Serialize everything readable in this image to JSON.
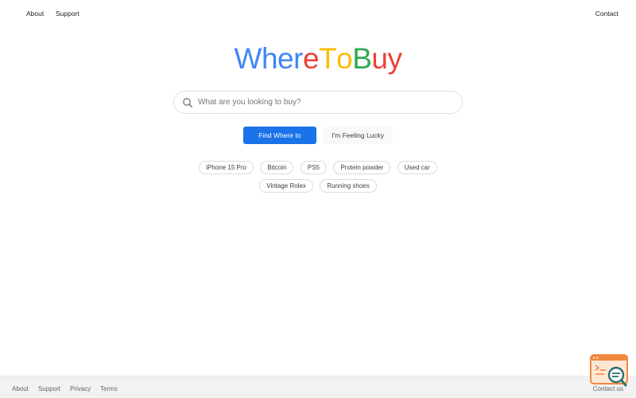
{
  "header": {
    "about_label": "About",
    "support_label": "Support",
    "contact_label": "Contact"
  },
  "logo": {
    "letters": [
      {
        "char": "W",
        "color": "#4285f4"
      },
      {
        "char": "h",
        "color": "#4285f4"
      },
      {
        "char": "e",
        "color": "#4285f4"
      },
      {
        "char": "r",
        "color": "#4285f4"
      },
      {
        "char": "e",
        "color": "#ea4335"
      },
      {
        "char": "T",
        "color": "#fbbc05"
      },
      {
        "char": "o",
        "color": "#fbbc05"
      },
      {
        "char": "B",
        "color": "#34a853"
      },
      {
        "char": "u",
        "color": "#ea4335"
      },
      {
        "char": "y",
        "color": "#ea4335"
      }
    ]
  },
  "search": {
    "placeholder": "What are you looking to buy?",
    "value": "",
    "icon": "search-icon"
  },
  "actions": {
    "primary_label": "Find Where to Buy",
    "secondary_label": "I'm Feeling Lucky",
    "primary_color": "#1a73e8"
  },
  "suggestions": [
    "iPhone 15 Pro",
    "Bitcoin",
    "PS5",
    "Protein powder",
    "Used car",
    "Vintage Rolex",
    "Running shoes"
  ],
  "footer": {
    "about_label": "About",
    "support_label": "Support",
    "privacy_label": "Privacy",
    "terms_label": "Terms",
    "contact_label": "Contact us"
  },
  "overlay_badge": {
    "icon": "search-console-icon",
    "color": "#f0883e"
  }
}
